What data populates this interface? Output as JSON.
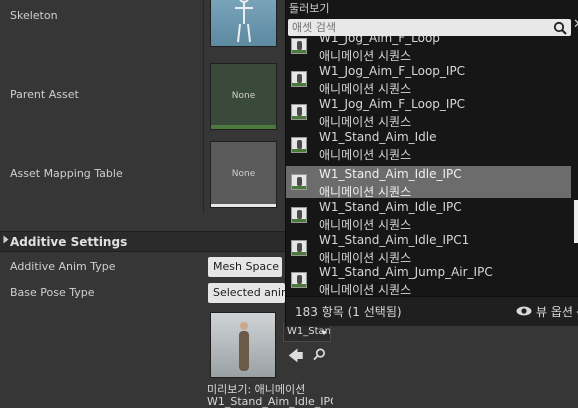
{
  "details": {
    "skeleton_label": "Skeleton",
    "parent_asset_label": "Parent Asset",
    "parent_asset_value": "None",
    "asset_mapping_label": "Asset Mapping Table",
    "asset_mapping_value": "None",
    "additive_section_title": "Additive Settings",
    "additive_anim_type_label": "Additive Anim Type",
    "additive_anim_type_value": "Mesh Space",
    "base_pose_type_label": "Base Pose Type",
    "base_pose_type_value": "Selected animation",
    "preview_anim_combo": "W1_Stand",
    "preview_label": "미리보기: 애니메이션",
    "preview_name": "W1_Stand_Aim_Idle_IPC"
  },
  "picker": {
    "title": "둘러보기",
    "search_placeholder": "애셋 검색",
    "items": [
      {
        "name": "W1_Jog_Aim_F_Loop",
        "type": "애니메이션 시퀀스",
        "selected": false
      },
      {
        "name": "W1_Jog_Aim_F_Loop_IPC",
        "type": "애니메이션 시퀀스",
        "selected": false
      },
      {
        "name": "W1_Jog_Aim_F_Loop_IPC",
        "type": "애니메이션 시퀀스",
        "selected": false
      },
      {
        "name": "W1_Stand_Aim_Idle",
        "type": "애니메이션 시퀀스",
        "selected": false
      },
      {
        "name": "W1_Stand_Aim_Idle_IPC",
        "type": "애니메이션 시퀀스",
        "selected": true
      },
      {
        "name": "W1_Stand_Aim_Idle_IPC",
        "type": "애니메이션 시퀀스",
        "selected": false
      },
      {
        "name": "W1_Stand_Aim_Idle_IPC1",
        "type": "애니메이션 시퀀스",
        "selected": false
      },
      {
        "name": "W1_Stand_Aim_Jump_Air_IPC",
        "type": "애니메이션 시퀀스",
        "selected": false
      }
    ],
    "count_text": "183 항목 (1 선택됨)",
    "view_options": "뷰 옵션"
  },
  "colors": {
    "selected_row": "#6c6c6c",
    "thumbnail_accent": "#4c7a3c"
  },
  "icons": [
    "search-icon",
    "close-icon",
    "eye-icon",
    "back-arrow-icon",
    "animation-asset-icon"
  ]
}
